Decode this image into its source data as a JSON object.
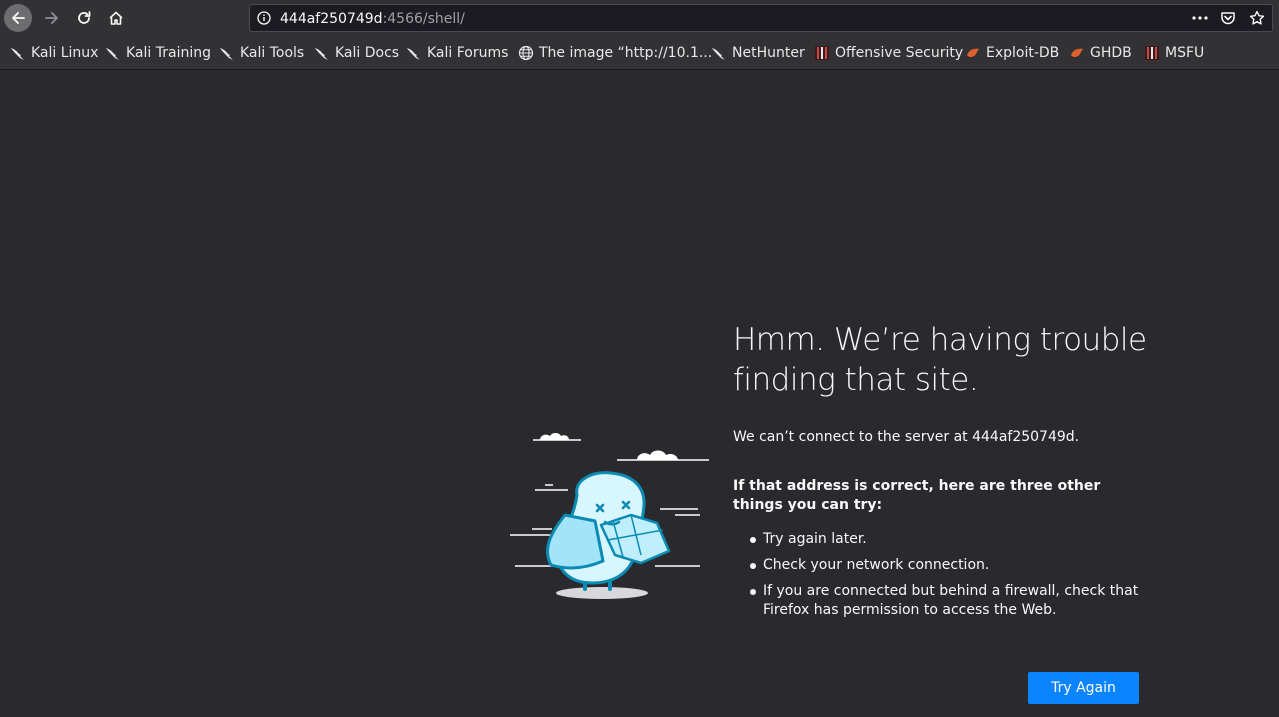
{
  "browser": {
    "url_host": "444af250749d",
    "url_rest": ":4566/shell/"
  },
  "bookmarks": [
    {
      "label": "Kali Linux",
      "icon": "kali-dragon-icon"
    },
    {
      "label": "Kali Training",
      "icon": "kali-dragon-icon"
    },
    {
      "label": "Kali Tools",
      "icon": "kali-dragon-icon"
    },
    {
      "label": "Kali Docs",
      "icon": "kali-dragon-icon"
    },
    {
      "label": "Kali Forums",
      "icon": "kali-dragon-icon"
    },
    {
      "label": "The image “http://10.1...",
      "icon": "globe-icon"
    },
    {
      "label": "NetHunter",
      "icon": "kali-dragon-icon"
    },
    {
      "label": "Offensive Security",
      "icon": "offsec-icon"
    },
    {
      "label": "Exploit-DB",
      "icon": "exploitdb-icon"
    },
    {
      "label": "GHDB",
      "icon": "exploitdb-icon"
    },
    {
      "label": "MSFU",
      "icon": "offsec-icon"
    }
  ],
  "error": {
    "title": "Hmm. We’re having trouble finding that site.",
    "lead": "We can’t connect to the server at 444af250749d.",
    "intro": "If that address is correct, here are three other things you can try:",
    "suggestions": [
      "Try again later.",
      "Check your network connection.",
      "If you are connected but behind a firewall, check that Firefox has permission to access the Web."
    ],
    "button_label": "Try Again"
  },
  "colors": {
    "page_bg": "#2a2a2e",
    "toolbar_bg": "#323234",
    "accent": "#0a84ff"
  }
}
